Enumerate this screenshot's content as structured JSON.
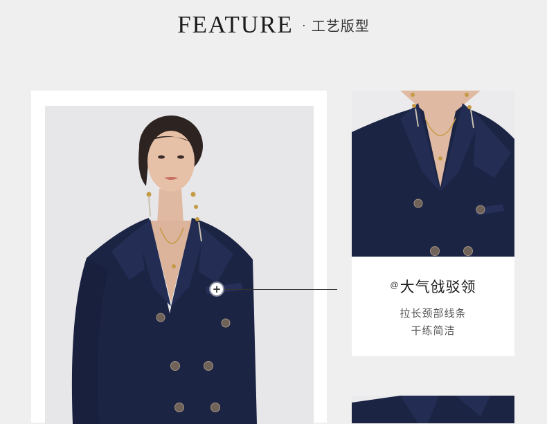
{
  "header": {
    "title_en": "FEATURE",
    "separator": "·",
    "title_cn": "工艺版型"
  },
  "main": {
    "model_photo": "woman-in-navy-double-breasted-blazer",
    "hotspot": {
      "icon": "plus-icon",
      "symbol": "+"
    },
    "caption": {
      "mark": "@",
      "title": "大气戗驳领",
      "line1": "拉长颈部线条",
      "line2": "干练简洁"
    },
    "detail_photos": [
      "collar-closeup",
      "jacket-closeup"
    ]
  },
  "colors": {
    "background": "#efefef",
    "card": "#ffffff",
    "jacket_navy": "#1c2444",
    "text_dark": "#1c1c1c"
  }
}
